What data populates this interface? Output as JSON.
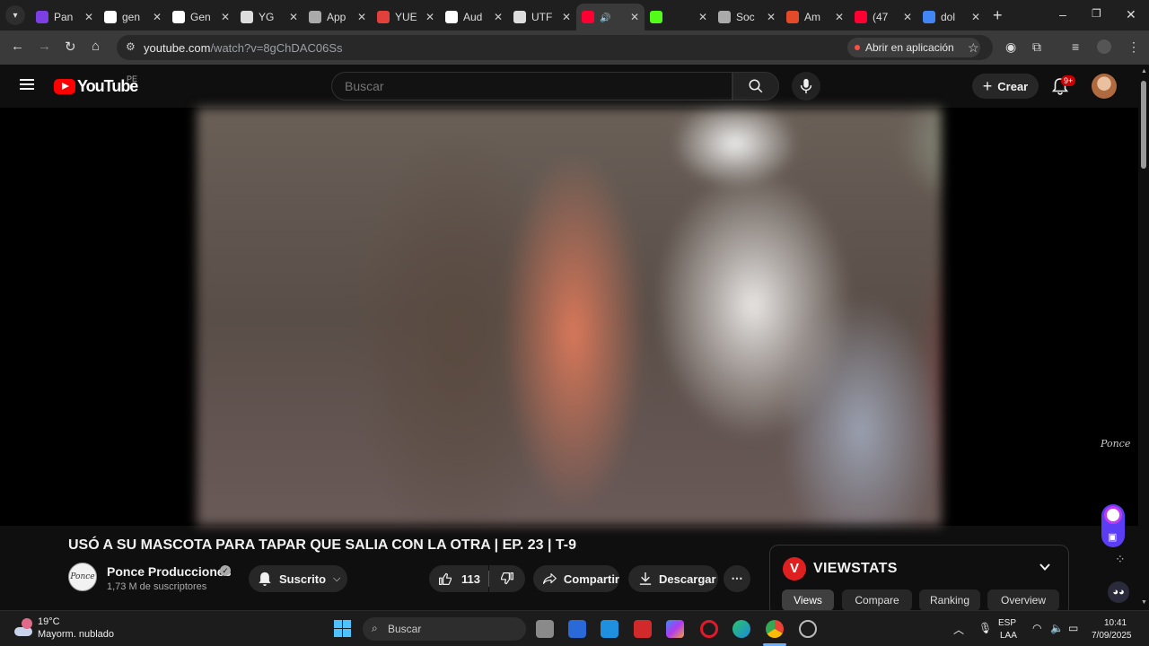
{
  "browser": {
    "tabs": [
      {
        "title": "Pan",
        "favicon_color": "#7b3fe4"
      },
      {
        "title": "gen",
        "favicon_color": "#ffffff"
      },
      {
        "title": "Gen",
        "favicon_color": "#ffffff"
      },
      {
        "title": "YG",
        "favicon_color": "#dddddd"
      },
      {
        "title": "App",
        "favicon_color": "#aaaaaa"
      },
      {
        "title": "YUE",
        "favicon_color": "#e2403a"
      },
      {
        "title": "Aud",
        "favicon_color": "#ffffff"
      },
      {
        "title": "UTF",
        "favicon_color": "#dddddd"
      },
      {
        "title": "",
        "favicon_color": "#ff0033",
        "active": true
      },
      {
        "title": "",
        "favicon_color": "#53fc18"
      },
      {
        "title": "Soc",
        "favicon_color": "#aaaaaa"
      },
      {
        "title": "Am",
        "favicon_color": "#e24a2a"
      },
      {
        "title": "(47",
        "favicon_color": "#ff0033"
      },
      {
        "title": "dol",
        "favicon_color": "#4285f4"
      }
    ],
    "url_host": "youtube.com",
    "url_path": "/watch?v=8gChDAC06Ss",
    "open_in_app_label": "Abrir en aplicación"
  },
  "youtube": {
    "logo_text": "YouTube",
    "region": "PE",
    "search_placeholder": "Buscar",
    "create_label": "Crear",
    "notifications_badge": "9+",
    "accent_color": "#ff0000"
  },
  "video": {
    "title": "USÓ A SU MASCOTA PARA TAPAR QUE SALIA CON LA OTRA | EP. 23 | T-9",
    "watermark": "Ponce",
    "channel": {
      "name": "Ponce Producciones",
      "subscribers": "1,73 M de suscriptores",
      "avatar_text": "Ponce"
    },
    "subscribed_label": "Suscrito",
    "likes": "113",
    "share_label": "Compartir",
    "download_label": "Descargar"
  },
  "viewstats": {
    "logo_letter": "V",
    "title": "VIEWSTATS",
    "tabs": [
      "Views",
      "Compare",
      "Ranking",
      "Overview"
    ],
    "active_tab": "Views"
  },
  "taskbar": {
    "weather_temp": "19°C",
    "weather_desc": "Mayorm. nublado",
    "search_placeholder": "Buscar",
    "language": "ESP",
    "language_sub": "LAA",
    "time": "10:41",
    "date": "7/09/2025"
  }
}
